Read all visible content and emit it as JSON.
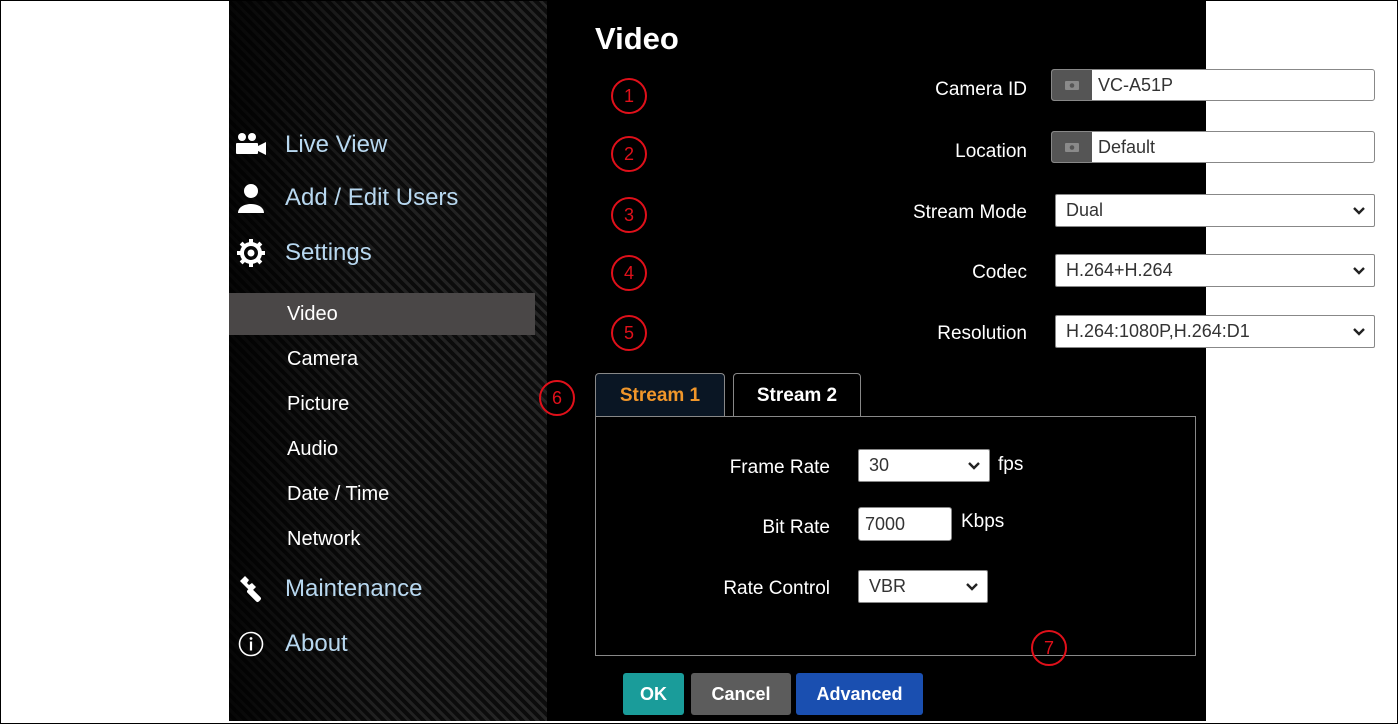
{
  "page_title": "Video",
  "sidebar": {
    "main_items": [
      {
        "label": "Live View",
        "icon": "camera-users-icon"
      },
      {
        "label": "Add / Edit Users",
        "icon": "user-icon"
      },
      {
        "label": "Settings",
        "icon": "gear-icon"
      },
      {
        "label": "Maintenance",
        "icon": "wrench-icon"
      },
      {
        "label": "About",
        "icon": "info-icon"
      }
    ],
    "sub_items": [
      {
        "label": "Video",
        "active": true
      },
      {
        "label": "Camera",
        "active": false
      },
      {
        "label": "Picture",
        "active": false
      },
      {
        "label": "Audio",
        "active": false
      },
      {
        "label": "Date / Time",
        "active": false
      },
      {
        "label": "Network",
        "active": false
      }
    ]
  },
  "form": {
    "camera_id": {
      "label": "Camera ID",
      "value": "VC-A51P"
    },
    "location": {
      "label": "Location",
      "value": "Default"
    },
    "stream_mode": {
      "label": "Stream Mode",
      "value": "Dual"
    },
    "codec": {
      "label": "Codec",
      "value": "H.264+H.264"
    },
    "resolution": {
      "label": "Resolution",
      "value": "H.264:1080P,H.264:D1"
    }
  },
  "tabs": [
    {
      "label": "Stream 1",
      "active": true
    },
    {
      "label": "Stream 2",
      "active": false
    }
  ],
  "stream_panel": {
    "frame_rate": {
      "label": "Frame Rate",
      "value": "30",
      "unit": "fps"
    },
    "bit_rate": {
      "label": "Bit Rate",
      "value": "7000",
      "unit": "Kbps"
    },
    "rate_control": {
      "label": "Rate Control",
      "value": "VBR"
    }
  },
  "buttons": {
    "ok": "OK",
    "cancel": "Cancel",
    "advanced": "Advanced"
  },
  "markers": [
    "1",
    "2",
    "3",
    "4",
    "5",
    "6",
    "7"
  ],
  "colors": {
    "sidebar_link": "#b8d8f0",
    "tab_active_text": "#f0962a",
    "marker": "#e0101a",
    "ok_button": "#1a9c9a",
    "cancel_button": "#5c5c5c",
    "advanced_button": "#1a4fb0"
  }
}
